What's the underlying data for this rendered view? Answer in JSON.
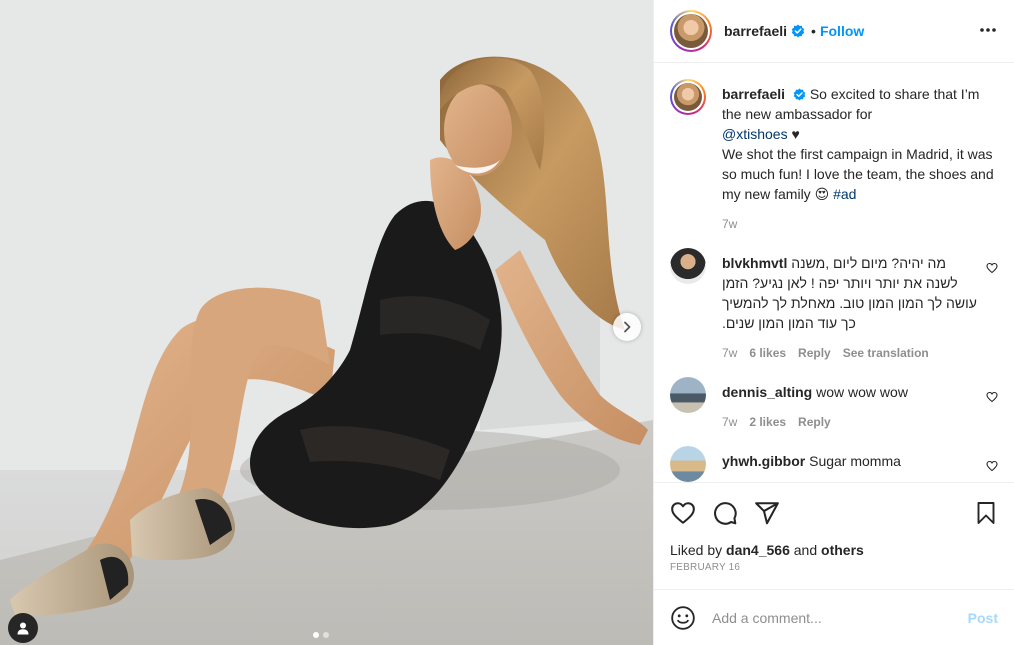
{
  "post": {
    "username": "barrefaeli",
    "follow_label": "Follow",
    "separator": "•",
    "more_icon": "more-horizontal-icon"
  },
  "caption": {
    "username": "barrefaeli",
    "text_1": "So excited to share that I’m the new ambassador for",
    "mention": "@xtishoes",
    "heart": "♥",
    "text_2": "We shot the first campaign in Madrid, it was so much fun! I love the team, the shoes and my new family",
    "emoji": "😍",
    "hashtag": "#ad",
    "time": "7w"
  },
  "comments": [
    {
      "username": "blvkhmvtl",
      "text": "מה יהיה? מיום ליום ,משנה לשנה את יותר ויותר יפה ! לאן נגיע? הזמן עושה לך המון המון טוב. מאחלת לך להמשיך כך עוד המון המון שנים.",
      "time": "7w",
      "likes": "6 likes",
      "reply": "Reply",
      "translate": "See translation"
    },
    {
      "username": "dennis_alting",
      "text": "wow wow wow",
      "time": "7w",
      "likes": "2 likes",
      "reply": "Reply"
    },
    {
      "username": "yhwh.gibbor",
      "text": "Sugar momma"
    }
  ],
  "liked_by": {
    "prefix": "Liked by",
    "user": "dan4_566",
    "conj": "and",
    "others": "others"
  },
  "date": "FEBRUARY 16",
  "add_comment": {
    "placeholder": "Add a comment...",
    "post_label": "Post"
  },
  "carousel": {
    "total": 2,
    "current": 1
  },
  "colors": {
    "accent": "#0095f6",
    "verified": "#0095f6",
    "link": "#00376b",
    "muted": "#8e8e8e"
  }
}
